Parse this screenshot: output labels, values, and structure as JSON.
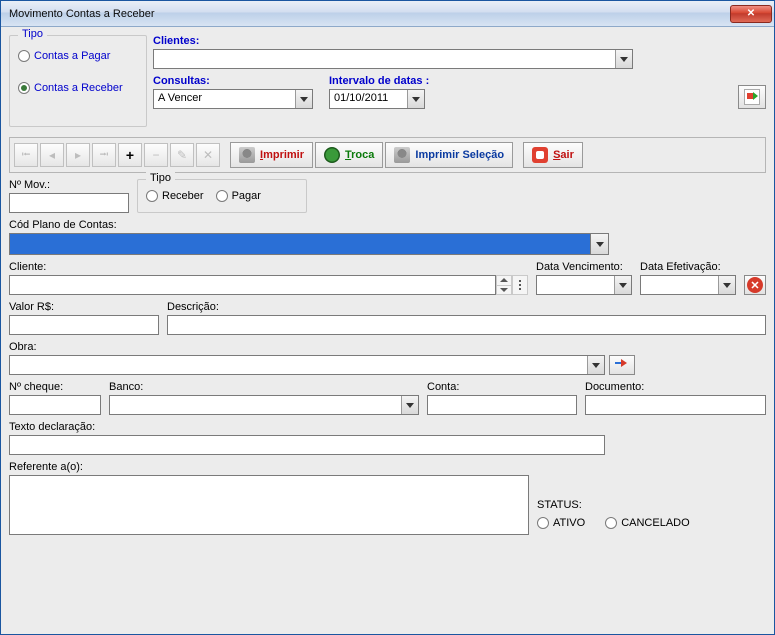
{
  "window": {
    "title": "Movimento Contas a Receber"
  },
  "top": {
    "tipo_group": "Tipo",
    "radio_pagar": "Contas a Pagar",
    "radio_receber": "Contas a Receber",
    "clientes_label": "Clientes:",
    "clientes_value": "",
    "consultas_label": "Consultas:",
    "consultas_value": "A Vencer",
    "intervalo_label": "Intervalo de datas :",
    "intervalo_value": "01/10/2011"
  },
  "toolbar": {
    "imprimir": "Imprimir",
    "troca": "Troca",
    "imprimir_selecao": "Imprimir Seleção",
    "sair": "Sair"
  },
  "form": {
    "nmov_label": "Nº Mov.:",
    "nmov_value": "",
    "tipo_group": "Tipo",
    "radio_receber": "Receber",
    "radio_pagar": "Pagar",
    "cod_plano_label": "Cód Plano de Contas:",
    "cod_plano_value": "",
    "cliente_label": "Cliente:",
    "cliente_value": "",
    "data_venc_label": "Data Vencimento:",
    "data_venc_value": "",
    "data_efet_label": "Data Efetivação:",
    "data_efet_value": "",
    "valor_label": "Valor R$:",
    "valor_value": "",
    "descricao_label": "Descrição:",
    "descricao_value": "",
    "obra_label": "Obra:",
    "obra_value": "",
    "ncheque_label": "Nº cheque:",
    "ncheque_value": "",
    "banco_label": "Banco:",
    "banco_value": "",
    "conta_label": "Conta:",
    "conta_value": "",
    "documento_label": "Documento:",
    "documento_value": "",
    "texto_label": "Texto declaração:",
    "texto_value": "",
    "referente_label": "Referente a(o):",
    "referente_value": "",
    "status_label": "STATUS:",
    "status_ativo": "ATIVO",
    "status_cancelado": "CANCELADO"
  }
}
